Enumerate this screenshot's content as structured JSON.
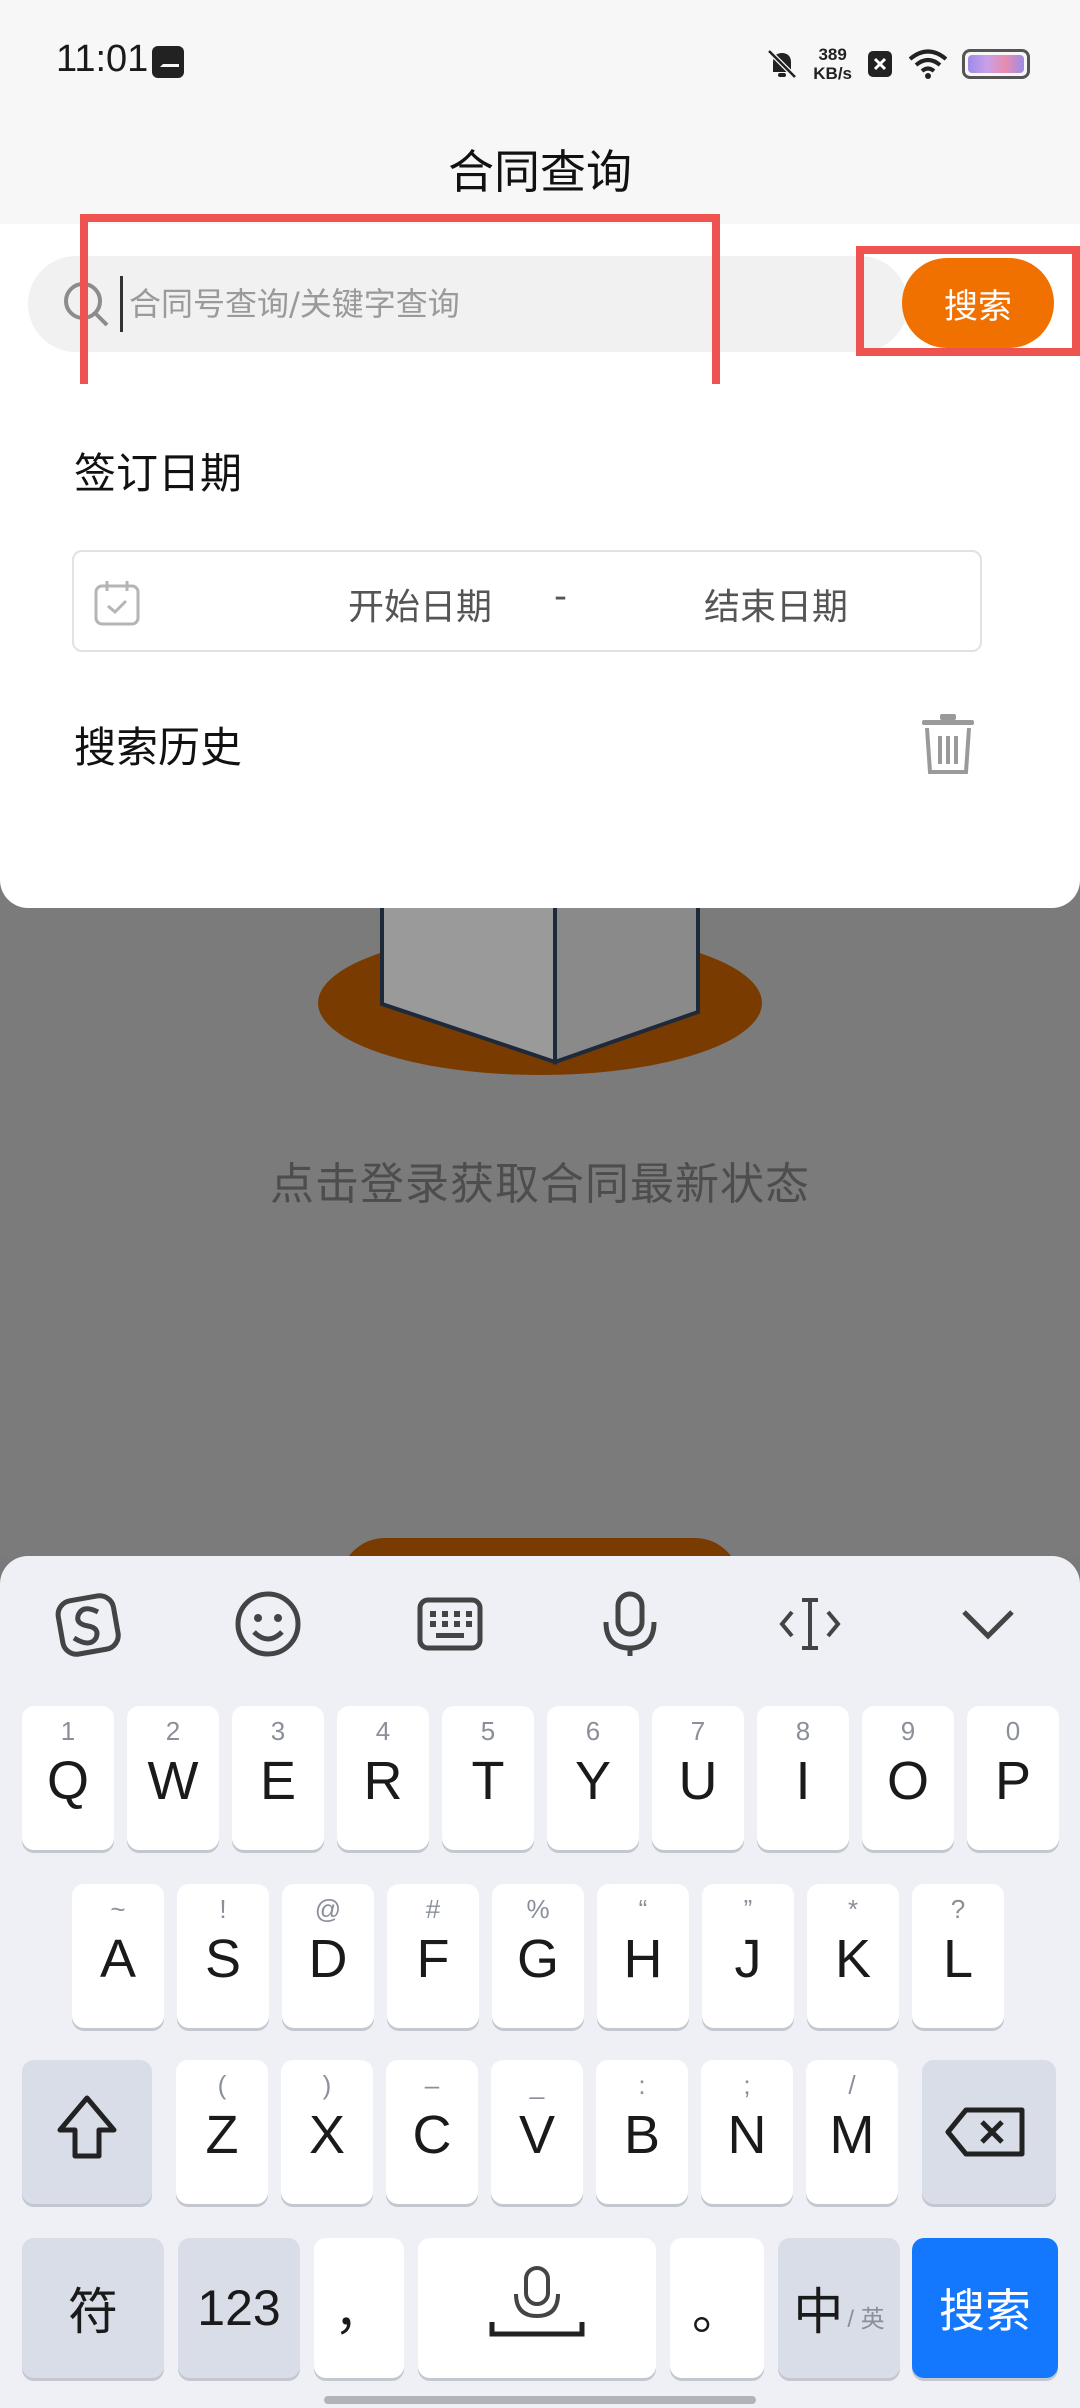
{
  "status_bar": {
    "time": "11:01",
    "speed_value": "389",
    "speed_unit": "KB/s"
  },
  "header": {
    "title": "合同查询"
  },
  "search": {
    "placeholder": "合同号查询/关键字查询",
    "button_label": "搜索"
  },
  "filter": {
    "date_label": "签订日期",
    "start_placeholder": "开始日期",
    "separator": "-",
    "end_placeholder": "结束日期",
    "history_label": "搜索历史"
  },
  "background": {
    "hint": "点击登录获取合同最新状态"
  },
  "keyboard": {
    "toolbar": [
      "sogou-logo-icon",
      "emoji-icon",
      "keyboard-icon",
      "microphone-icon",
      "cursor-icon",
      "collapse-chevron-icon"
    ],
    "row1": [
      {
        "hint": "1",
        "key": "Q"
      },
      {
        "hint": "2",
        "key": "W"
      },
      {
        "hint": "3",
        "key": "E"
      },
      {
        "hint": "4",
        "key": "R"
      },
      {
        "hint": "5",
        "key": "T"
      },
      {
        "hint": "6",
        "key": "Y"
      },
      {
        "hint": "7",
        "key": "U"
      },
      {
        "hint": "8",
        "key": "I"
      },
      {
        "hint": "9",
        "key": "O"
      },
      {
        "hint": "0",
        "key": "P"
      }
    ],
    "row2": [
      {
        "hint": "~",
        "key": "A"
      },
      {
        "hint": "!",
        "key": "S"
      },
      {
        "hint": "@",
        "key": "D"
      },
      {
        "hint": "#",
        "key": "F"
      },
      {
        "hint": "%",
        "key": "G"
      },
      {
        "hint": "“",
        "key": "H"
      },
      {
        "hint": "”",
        "key": "J"
      },
      {
        "hint": "*",
        "key": "K"
      },
      {
        "hint": "?",
        "key": "L"
      }
    ],
    "row3": [
      {
        "hint": "(",
        "key": "Z"
      },
      {
        "hint": ")",
        "key": "X"
      },
      {
        "hint": "–",
        "key": "C"
      },
      {
        "hint": "_",
        "key": "V"
      },
      {
        "hint": ":",
        "key": "B"
      },
      {
        "hint": ";",
        "key": "N"
      },
      {
        "hint": "/",
        "key": "M"
      }
    ],
    "symbols_label": "符",
    "numbers_label": "123",
    "comma_label": "，",
    "period_label": "。",
    "lang_main": "中",
    "lang_sub": "/ 英",
    "search_label": "搜索"
  },
  "colors": {
    "accent_orange": "#f07000",
    "keyboard_blue": "#1478ff",
    "highlight_red": "#ef5350"
  }
}
